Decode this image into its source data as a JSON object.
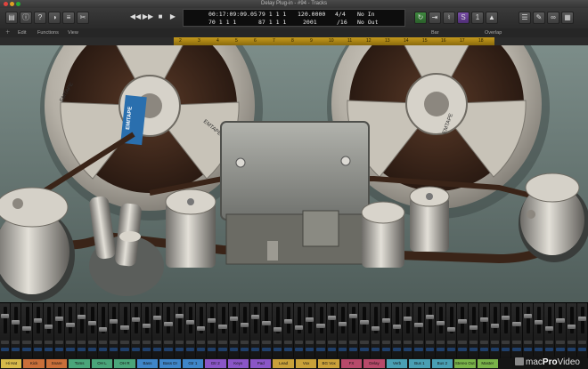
{
  "window": {
    "title": "Delay Plug-in - #94 - Tracks"
  },
  "lcd": {
    "time_top": "00:17:09:09.05",
    "time_bottom": "70 1 1 1",
    "bar_top": "79 1 1 1",
    "bar_bottom": "87 1 1 1",
    "tempo": "120.0000",
    "tempo_sub": "2001",
    "sig_top": "4/4",
    "sig_bottom": "/16",
    "in_label": "No In",
    "out_label": "No Out"
  },
  "menubar": {
    "edit": "Edit",
    "functions": "Functions",
    "view": "View",
    "snap": "Bar",
    "drag": "Overlap"
  },
  "ruler": {
    "ticks": [
      "2",
      "3",
      "4",
      "5",
      "6",
      "7",
      "8",
      "9",
      "10",
      "11",
      "12",
      "13",
      "14",
      "15",
      "16",
      "17",
      "18"
    ]
  },
  "plugin": {
    "reel_brand": "EMTAPE",
    "label_text": "EMITAPE"
  },
  "colors": {
    "accent_yellow": "#c59a1c",
    "panel_bg": "#6e7f7b",
    "reel_metal": "#b9b5ad",
    "tape_brown": "#3a2418",
    "label_blue": "#2a6fae"
  },
  "mixer": {
    "strip_count": 54
  },
  "track_names": [
    {
      "label": "Hi Hat",
      "color": "#d7b94a"
    },
    {
      "label": "Kick",
      "color": "#c96f3a"
    },
    {
      "label": "Snare",
      "color": "#c96f3a"
    },
    {
      "label": "Toms",
      "color": "#4aa57a"
    },
    {
      "label": "OH L",
      "color": "#4aa57a"
    },
    {
      "label": "OH R",
      "color": "#4aa57a"
    },
    {
      "label": "Bass",
      "color": "#3f86c9"
    },
    {
      "label": "Bass DI",
      "color": "#3f86c9"
    },
    {
      "label": "Gtr 1",
      "color": "#3f86c9"
    },
    {
      "label": "Gtr 2",
      "color": "#8a56c6"
    },
    {
      "label": "Keys",
      "color": "#8a56c6"
    },
    {
      "label": "Pad",
      "color": "#8a56c6"
    },
    {
      "label": "Lead",
      "color": "#c9a13a"
    },
    {
      "label": "Vox",
      "color": "#c9a13a"
    },
    {
      "label": "BG Vox",
      "color": "#c9a13a"
    },
    {
      "label": "FX",
      "color": "#b74a6a"
    },
    {
      "label": "Delay",
      "color": "#b74a6a"
    },
    {
      "label": "Verb",
      "color": "#4a9fb3"
    },
    {
      "label": "Bus 1",
      "color": "#4a9fb3"
    },
    {
      "label": "Bus 2",
      "color": "#4a9fb3"
    },
    {
      "label": "Stereo Out",
      "color": "#7ab34a"
    },
    {
      "label": "Master",
      "color": "#7ab34a"
    }
  ],
  "watermark": {
    "part1": "mac",
    "part2": "Pro",
    "part3": "Video"
  }
}
